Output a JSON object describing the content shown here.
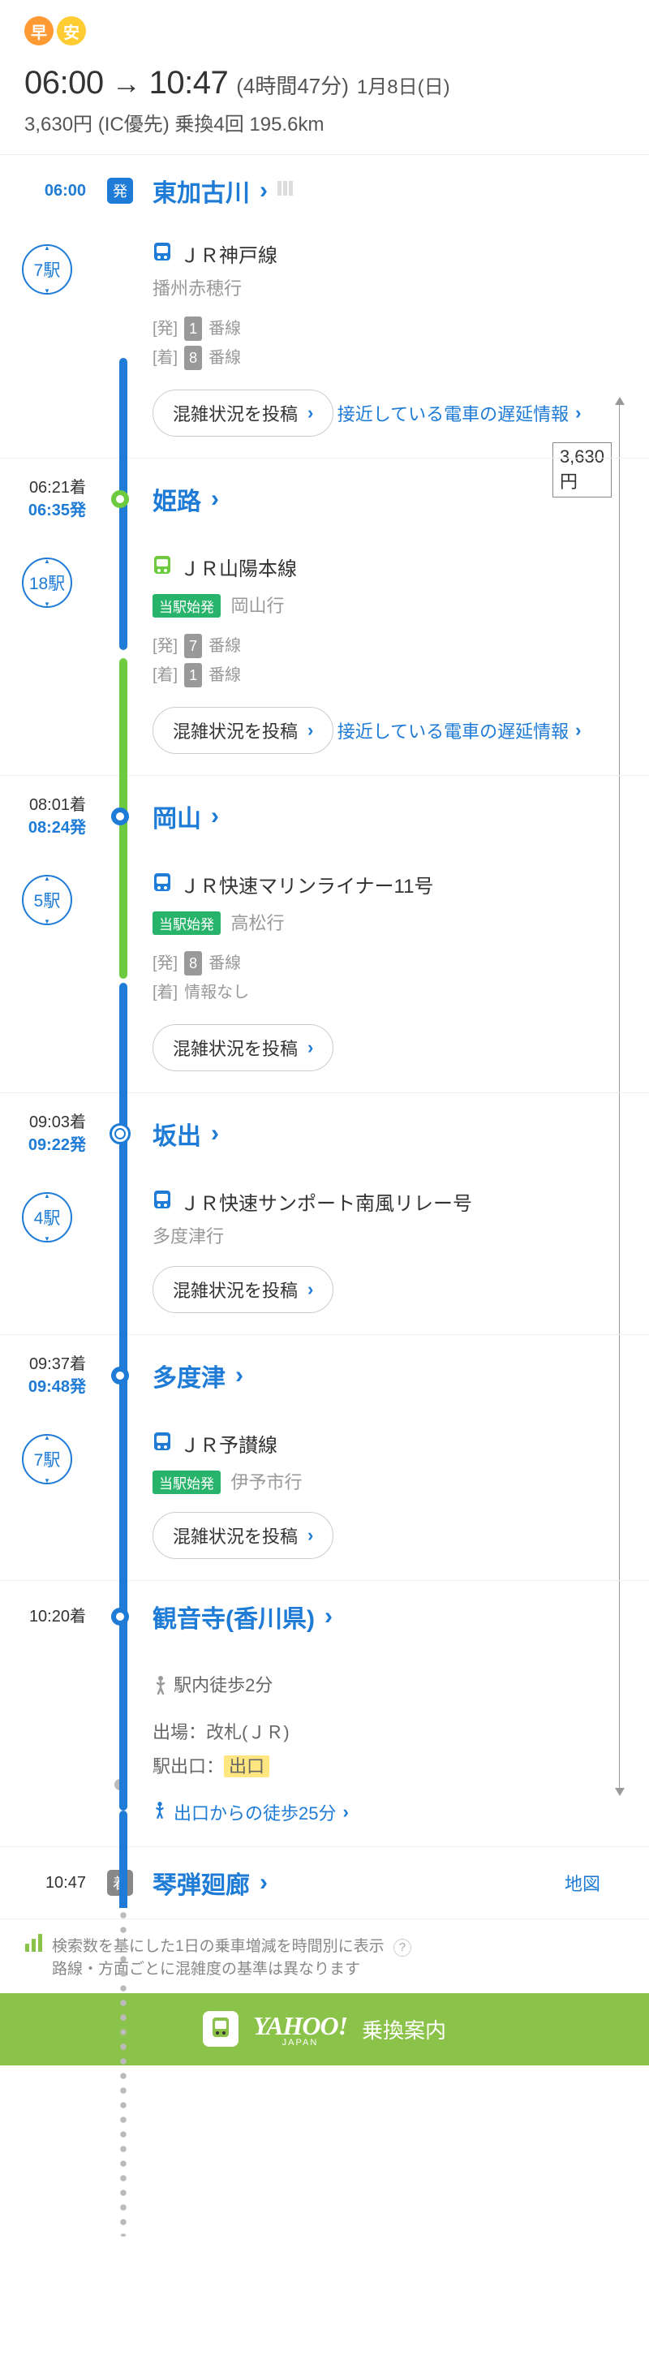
{
  "badges": {
    "early": "早",
    "cheap": "安"
  },
  "summary": {
    "dep_time": "06:00",
    "arr_time": "10:47",
    "arrow": "→",
    "duration": "(4時間47分)",
    "date": "1月8日(日)",
    "fare": "3,630円 (IC優先) 乗換4回 195.6km"
  },
  "price_side": "3,630円",
  "stations": {
    "s0": {
      "time_dep": "06:00",
      "dep_label": "発",
      "name": "東加古川"
    },
    "s1": {
      "time_arr": "06:21着",
      "time_dep": "06:35発",
      "name": "姫路"
    },
    "s2": {
      "time_arr": "08:01着",
      "time_dep": "08:24発",
      "name": "岡山"
    },
    "s3": {
      "time_arr": "09:03着",
      "time_dep": "09:22発",
      "name": "坂出"
    },
    "s4": {
      "time_arr": "09:37着",
      "time_dep": "09:48発",
      "name": "多度津"
    },
    "s5": {
      "time_arr": "10:20着",
      "name": "観音寺(香川県)"
    },
    "s6": {
      "time_arr": "10:47",
      "arr_label": "着",
      "name": "琴弾廻廊",
      "map": "地図"
    }
  },
  "segments": {
    "seg0": {
      "count": "7駅",
      "line": "ＪＲ神戸線",
      "dest": "播州赤穂行",
      "dep_plat_label": "[発]",
      "dep_plat": "1",
      "dep_plat_suf": "番線",
      "arr_plat_label": "[着]",
      "arr_plat": "8",
      "arr_plat_suf": "番線",
      "post": "混雑状況を投稿",
      "delay": "接近している電車の遅延情報"
    },
    "seg1": {
      "count": "18駅",
      "line": "ＪＲ山陽本線",
      "origin_badge": "当駅始発",
      "dest": "岡山行",
      "dep_plat_label": "[発]",
      "dep_plat": "7",
      "dep_plat_suf": "番線",
      "arr_plat_label": "[着]",
      "arr_plat": "1",
      "arr_plat_suf": "番線",
      "post": "混雑状況を投稿",
      "delay": "接近している電車の遅延情報"
    },
    "seg2": {
      "count": "5駅",
      "line": "ＪＲ快速マリンライナー11号",
      "origin_badge": "当駅始発",
      "dest": "高松行",
      "dep_plat_label": "[発]",
      "dep_plat": "8",
      "dep_plat_suf": "番線",
      "arr_plat_label": "[着]",
      "arr_plat_none": "情報なし",
      "post": "混雑状況を投稿"
    },
    "seg3": {
      "count": "4駅",
      "line": "ＪＲ快速サンポート南風リレー号",
      "dest": "多度津行",
      "post": "混雑状況を投稿"
    },
    "seg4": {
      "count": "7駅",
      "line": "ＪＲ予讃線",
      "origin_badge": "当駅始発",
      "dest": "伊予市行",
      "post": "混雑状況を投稿"
    },
    "walk": {
      "in_station": "駅内徒歩2分",
      "exit_label": "出場：",
      "exit_val": "改札(ＪＲ)",
      "door_label": "駅出口：",
      "door_val": "出口",
      "walk_link": "出口からの徒歩25分"
    }
  },
  "note": {
    "line1": "検索数を基にした1日の乗車増減を時間別に表示",
    "line2": "路線・方面ごとに混雑度の基準は異なります"
  },
  "footer": {
    "yahoo": "YAHOO!",
    "japan": "JAPAN",
    "text": "乗換案内"
  }
}
